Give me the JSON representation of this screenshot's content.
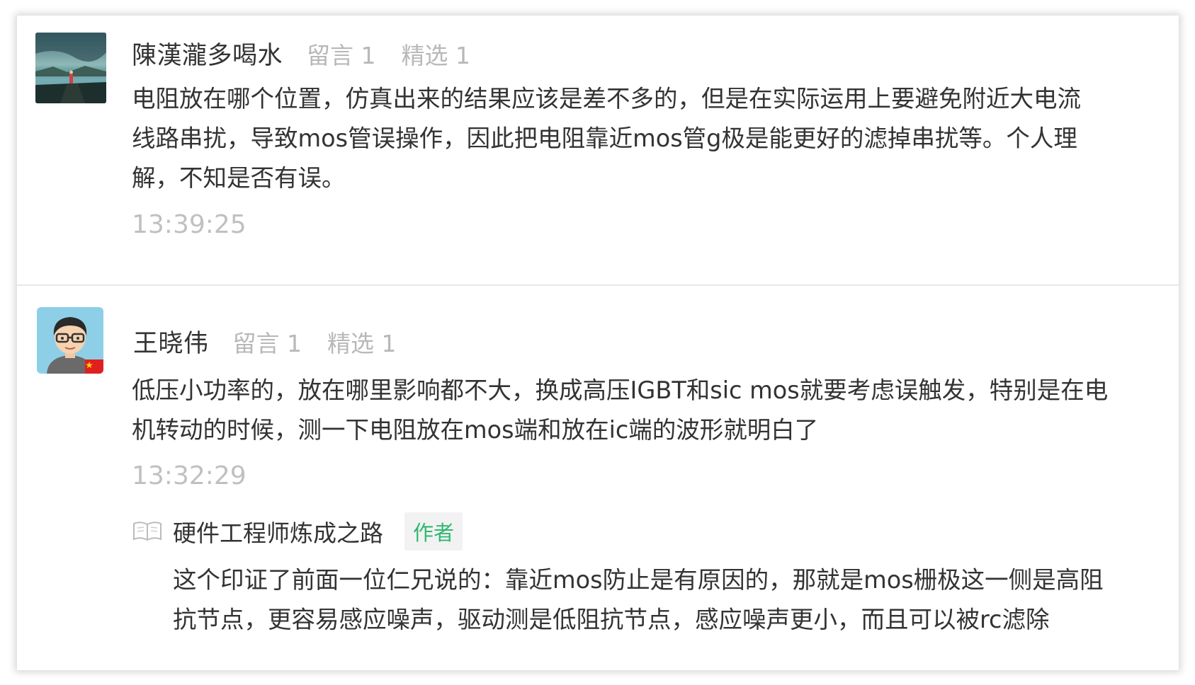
{
  "comments": [
    {
      "nickname": "陳漢瀧多喝水",
      "message_count": "留言 1",
      "featured_count": "精选 1",
      "content_lines": [
        "电阻放在哪个位置，仿真出来的结果应该是差不多的，但是在实际运用上要避免附近大电流",
        "线路串扰，导致mos管误操作，因此把电阻靠近mos管g极是能更好的滤掉串扰等。个人理",
        "解，不知是否有误。"
      ],
      "time": "13:39:25",
      "avatar_icon": "landscape-avatar-icon"
    },
    {
      "nickname": "王晓伟",
      "message_count": "留言 1",
      "featured_count": "精选 1",
      "content_lines": [
        "低压小功率的，放在哪里影响都不大，换成高压IGBT和sic mos就要考虑误触发，特别是在电",
        "机转动的时候，测一下电阻放在mos端和放在ic端的波形就明白了"
      ],
      "time": "13:32:29",
      "avatar_icon": "cartoon-person-avatar-icon",
      "reply": {
        "author": "硬件工程师炼成之路",
        "badge": "作者",
        "icon": "book-icon",
        "content_lines": [
          "这个印证了前面一位仁兄说的：靠近mos防止是有原因的，那就是mos栅极这一侧是高阻",
          "抗节点，更容易感应噪声，驱动测是低阻抗节点，感应噪声更小，而且可以被rc滤除"
        ]
      }
    }
  ],
  "colors": {
    "text": "#333333",
    "meta": "#b8b8b8",
    "time": "#c0c0c0",
    "author_badge_text": "#2eb872",
    "author_badge_bg": "#f2f2f2",
    "divider": "#e8e8e8"
  }
}
